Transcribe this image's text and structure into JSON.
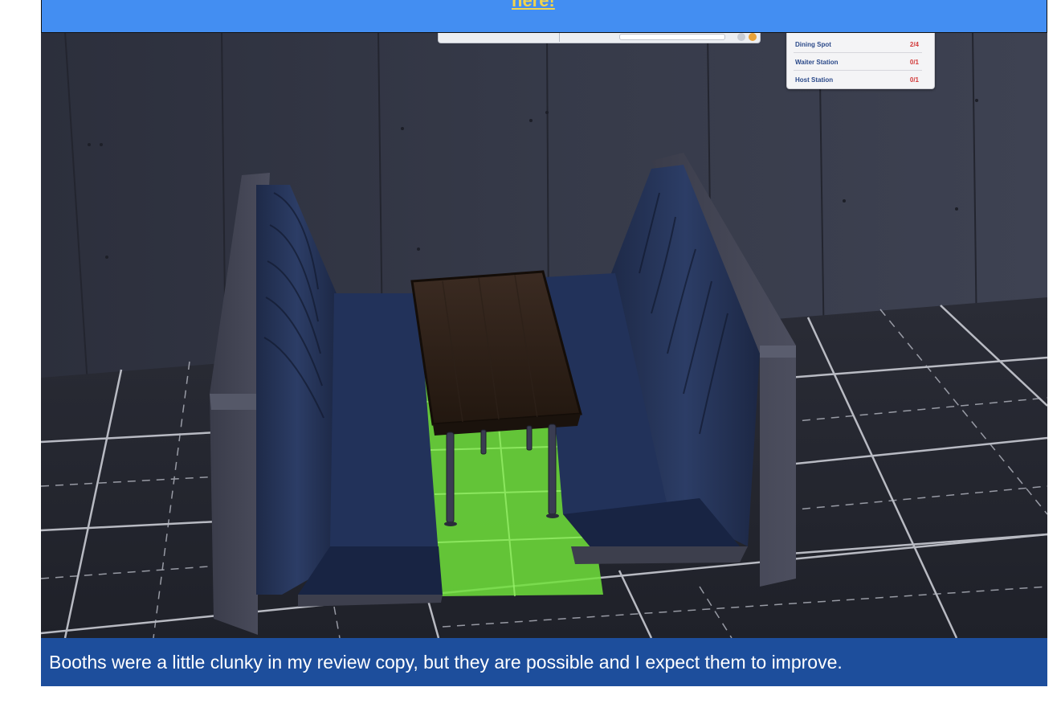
{
  "banner": {
    "link_text": "here!"
  },
  "game_ui": {
    "requirements": [
      {
        "name": "Dining Spot",
        "value": "2/4"
      },
      {
        "name": "Waiter Station",
        "value": "0/1"
      },
      {
        "name": "Host Station",
        "value": "0/1"
      }
    ]
  },
  "caption": {
    "text": "Booths were a little clunky in my review copy, but they are possible and I expect them to improve."
  },
  "colors": {
    "banner_bg": "#438ef2",
    "banner_link": "#f3d44a",
    "caption_bg": "#1d4e9c",
    "placement_highlight": "#6fe03a"
  }
}
